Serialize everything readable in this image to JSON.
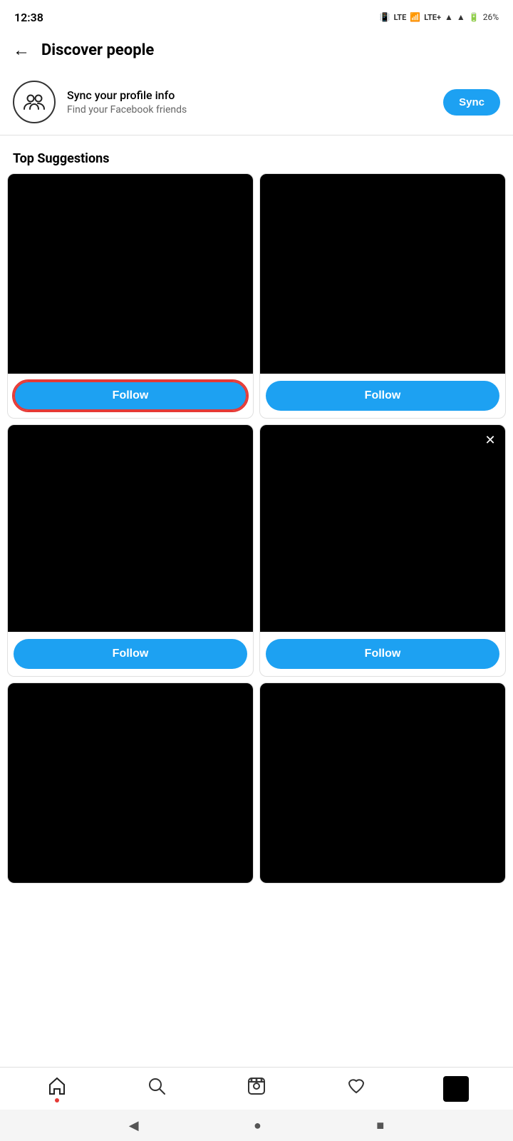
{
  "statusBar": {
    "time": "12:38",
    "battery": "26%",
    "signal": "LTE"
  },
  "header": {
    "title": "Discover people",
    "backLabel": "←"
  },
  "syncSection": {
    "title": "Sync your profile info",
    "subtitle": "Find your Facebook friends",
    "buttonLabel": "Sync"
  },
  "topSuggestions": {
    "sectionTitle": "Top Suggestions",
    "cards": [
      {
        "id": "card-1",
        "highlighted": true,
        "followLabel": "Follow",
        "showClose": false
      },
      {
        "id": "card-2",
        "highlighted": false,
        "followLabel": "Follow",
        "showClose": false
      },
      {
        "id": "card-3",
        "highlighted": false,
        "followLabel": "Follow",
        "showClose": false
      },
      {
        "id": "card-4",
        "highlighted": false,
        "followLabel": "Follow",
        "showClose": true
      },
      {
        "id": "card-5",
        "highlighted": false,
        "followLabel": "",
        "showClose": false
      },
      {
        "id": "card-6",
        "highlighted": false,
        "followLabel": "",
        "showClose": false
      }
    ]
  },
  "bottomNav": {
    "items": [
      {
        "icon": "home",
        "label": "Home",
        "hasDot": true
      },
      {
        "icon": "search",
        "label": "Search",
        "hasDot": false
      },
      {
        "icon": "video",
        "label": "Reels",
        "hasDot": false
      },
      {
        "icon": "heart",
        "label": "Notifications",
        "hasDot": false
      },
      {
        "icon": "avatar",
        "label": "Profile",
        "hasDot": false
      }
    ]
  },
  "androidNav": {
    "back": "◀",
    "home": "●",
    "recents": "■"
  }
}
